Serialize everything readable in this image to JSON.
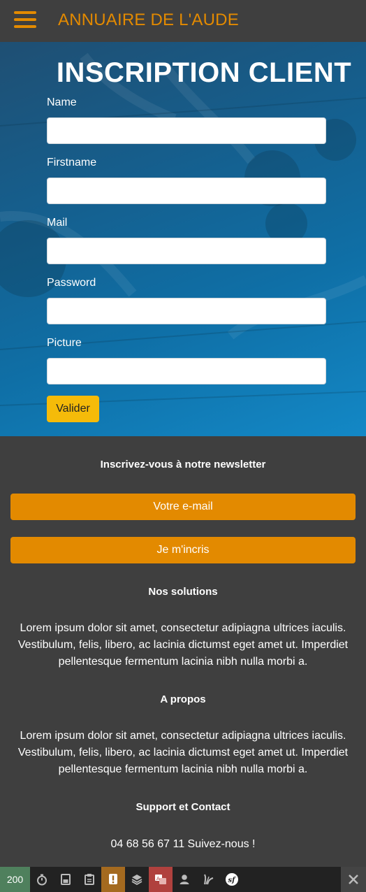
{
  "navbar": {
    "brand": "ANNUAIRE DE L'AUDE"
  },
  "hero": {
    "title": "INSCRIPTION CLIENT"
  },
  "form": {
    "name_label": "Name",
    "firstname_label": "Firstname",
    "mail_label": "Mail",
    "password_label": "Password",
    "picture_label": "Picture",
    "name_value": "",
    "firstname_value": "",
    "mail_value": "",
    "password_value": "",
    "picture_value": "",
    "submit_label": "Valider"
  },
  "newsletter": {
    "heading": "Inscrivez-vous à notre newsletter",
    "email_placeholder": "Votre e-mail",
    "subscribe_label": "Je m'incris"
  },
  "solutions": {
    "heading": "Nos solutions",
    "text": "Lorem ipsum dolor sit amet, consectetur adipiagna ultrices iaculis. Vestibulum, felis, libero, ac lacinia dictumst eget amet ut. Imperdiet pellentesque fermentum lacinia nibh nulla morbi a."
  },
  "about": {
    "heading": "A propos",
    "text": "Lorem ipsum dolor sit amet, consectetur adipiagna ultrices iaculis. Vestibulum, felis, libero, ac lacinia dictumst eget amet ut. Imperdiet pellentesque fermentum lacinia nibh nulla morbi a."
  },
  "contact": {
    "heading": "Support et Contact",
    "text": "04 68 56 67 11 Suivez-nous !"
  },
  "toolbar": {
    "status_code": "200",
    "icons": [
      "timer-icon",
      "memory-icon",
      "clipboard-icon",
      "warning-icon",
      "layers-icon",
      "translation-icon",
      "user-icon",
      "twig-icon",
      "symfony-icon"
    ],
    "status_color": "#4f805d",
    "warning_color": "#a46a1f",
    "error_color": "#b0413e"
  },
  "colors": {
    "accent": "#e38a00",
    "submit": "#f5bb09",
    "footer_bg": "#3f3f3f"
  }
}
